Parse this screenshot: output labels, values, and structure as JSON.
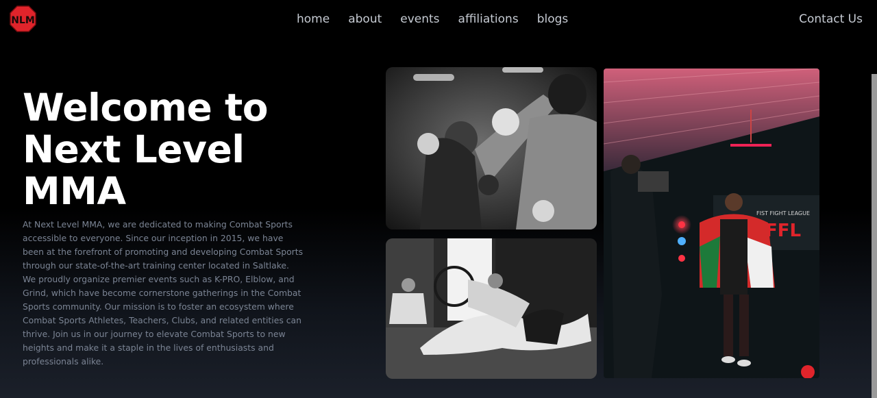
{
  "nav": {
    "logo_text": "NLM",
    "links": [
      "home",
      "about",
      "events",
      "affiliations",
      "blogs"
    ],
    "contact": "Contact Us"
  },
  "hero": {
    "title": "Welcome to Next Level MMA",
    "description": "At Next Level MMA, we are dedicated to making Combat Sports accessible to everyone. Since our inception in 2015, we have been at the forefront of promoting and developing Combat Sports through our state-of-the-art training center located in Saltlake. We proudly organize premier events such as K-PRO, Elblow, and Grind, which have become cornerstone gatherings in the Combat Sports community. Our mission is to foster an ecosystem where Combat Sports Athletes, Teachers, Clubs, and related entities can thrive. Join us in our journey to elevate Combat Sports to new heights and make it a staple in the lives of enthusiasts and professionals alike."
  },
  "gallery": {
    "banner_small": "FIST FIGHT LEAGUE",
    "banner_big": "FFL"
  },
  "colors": {
    "accent": "#e0242b",
    "nav_text": "#c6cbd3",
    "body_text": "#7b8494"
  }
}
